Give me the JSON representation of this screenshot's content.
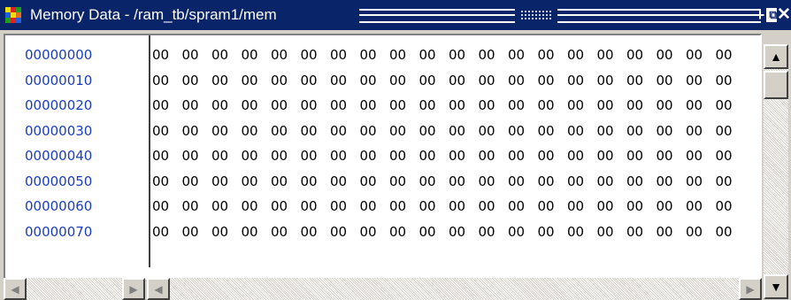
{
  "window": {
    "title": "Memory Data - /ram_tb/spram1/mem",
    "icon": "memory-grid-icon",
    "buttons": {
      "add": "+",
      "undock": "⧉",
      "close": "✕"
    }
  },
  "memory": {
    "rows": [
      {
        "address": "00000000",
        "values": [
          "00",
          "00",
          "00",
          "00",
          "00",
          "00",
          "00",
          "00",
          "00",
          "00",
          "00",
          "00",
          "00",
          "00",
          "00",
          "00",
          "00",
          "00",
          "00",
          "00"
        ]
      },
      {
        "address": "00000010",
        "values": [
          "00",
          "00",
          "00",
          "00",
          "00",
          "00",
          "00",
          "00",
          "00",
          "00",
          "00",
          "00",
          "00",
          "00",
          "00",
          "00",
          "00",
          "00",
          "00",
          "00"
        ]
      },
      {
        "address": "00000020",
        "values": [
          "00",
          "00",
          "00",
          "00",
          "00",
          "00",
          "00",
          "00",
          "00",
          "00",
          "00",
          "00",
          "00",
          "00",
          "00",
          "00",
          "00",
          "00",
          "00",
          "00"
        ]
      },
      {
        "address": "00000030",
        "values": [
          "00",
          "00",
          "00",
          "00",
          "00",
          "00",
          "00",
          "00",
          "00",
          "00",
          "00",
          "00",
          "00",
          "00",
          "00",
          "00",
          "00",
          "00",
          "00",
          "00"
        ]
      },
      {
        "address": "00000040",
        "values": [
          "00",
          "00",
          "00",
          "00",
          "00",
          "00",
          "00",
          "00",
          "00",
          "00",
          "00",
          "00",
          "00",
          "00",
          "00",
          "00",
          "00",
          "00",
          "00",
          "00"
        ]
      },
      {
        "address": "00000050",
        "values": [
          "00",
          "00",
          "00",
          "00",
          "00",
          "00",
          "00",
          "00",
          "00",
          "00",
          "00",
          "00",
          "00",
          "00",
          "00",
          "00",
          "00",
          "00",
          "00",
          "00"
        ]
      },
      {
        "address": "00000060",
        "values": [
          "00",
          "00",
          "00",
          "00",
          "00",
          "00",
          "00",
          "00",
          "00",
          "00",
          "00",
          "00",
          "00",
          "00",
          "00",
          "00",
          "00",
          "00",
          "00",
          "00"
        ]
      },
      {
        "address": "00000070",
        "values": [
          "00",
          "00",
          "00",
          "00",
          "00",
          "00",
          "00",
          "00",
          "00",
          "00",
          "00",
          "00",
          "00",
          "00",
          "00",
          "00",
          "00",
          "00",
          "00",
          "00"
        ]
      }
    ]
  },
  "colors": {
    "titlebar": "#0a246a",
    "address": "#1a3dbf"
  },
  "scroll_arrows": {
    "up": "▲",
    "down": "▼",
    "left": "◀",
    "right": "▶"
  }
}
